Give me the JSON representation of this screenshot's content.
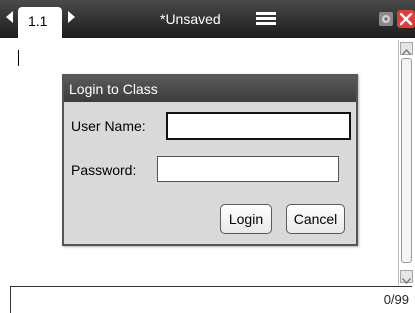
{
  "topbar": {
    "tab_label": "1.1",
    "doc_title": "*Unsaved"
  },
  "dialog": {
    "title": "Login to Class",
    "username_label": "User Name:",
    "username_value": "",
    "password_label": "Password:",
    "password_value": "",
    "login_label": "Login",
    "cancel_label": "Cancel"
  },
  "status": {
    "page_count": "0/99"
  },
  "colors": {
    "topbar": "#2b2b2b",
    "dialog_bg": "#d9d9d9",
    "close_red": "#e23b3b"
  }
}
